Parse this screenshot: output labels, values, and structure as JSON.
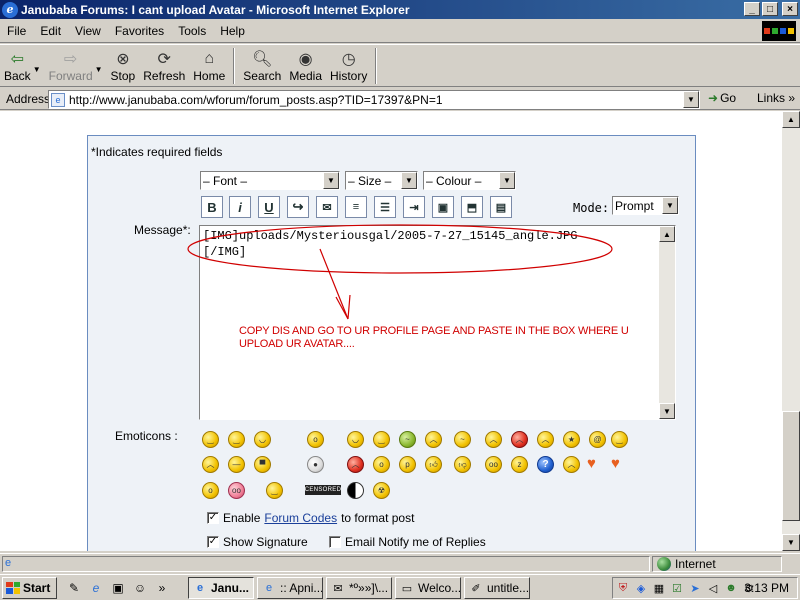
{
  "window": {
    "title": "Janubaba Forums: I cant upload Avatar - Microsoft Internet Explorer",
    "minimize": "_",
    "maximize": "□",
    "close": "×"
  },
  "menu": {
    "items": [
      "File",
      "Edit",
      "View",
      "Favorites",
      "Tools",
      "Help"
    ]
  },
  "toolbar": {
    "back": "Back",
    "forward": "Forward",
    "stop": "Stop",
    "refresh": "Refresh",
    "home": "Home",
    "search": "Search",
    "media": "Media",
    "history": "History"
  },
  "address": {
    "label": "Address",
    "url": "http://www.janubaba.com/wforum/forum_posts.asp?TID=17397&PN=1",
    "go": "Go",
    "links": "Links"
  },
  "form": {
    "required_note": "*Indicates required fields",
    "font_select": "– Font –",
    "size_select": "– Size –",
    "colour_select": "– Colour –",
    "mode_label": "Mode:",
    "mode_value": "Prompt",
    "message_label": "Message*:",
    "message_line1": "[IMG]uploads/Mysteriousgal/2005-7-27_15145_angle.JPG",
    "message_line2": "[/IMG]",
    "annotation": "COPY DIS AND GO TO UR PROFILE PAGE AND PASTE IN THE BOX WHERE U UPLOAD UR AVATAR....",
    "emoticons_label": "Emoticons :",
    "censored_label": "CENSORED",
    "enable_prefix": "Enable",
    "enable_link": "Forum Codes",
    "enable_suffix": "to format post",
    "show_signature": "Show Signature",
    "email_notify": "Email Notify me of Replies",
    "enable_checked": true,
    "signature_checked": true,
    "notify_checked": false
  },
  "status": {
    "zone": "Internet"
  },
  "taskbar": {
    "start": "Start",
    "tasks": [
      "Janu...",
      ":: Apni...",
      "*º»»]\\...",
      "Welco...",
      "untitle..."
    ],
    "clock": "3:13 PM"
  },
  "colors": {
    "title_gradient_start": "#0a246a",
    "title_gradient_end": "#3a6ea5",
    "annotation_red": "#d00000",
    "panel_border": "#6a8cc0"
  }
}
